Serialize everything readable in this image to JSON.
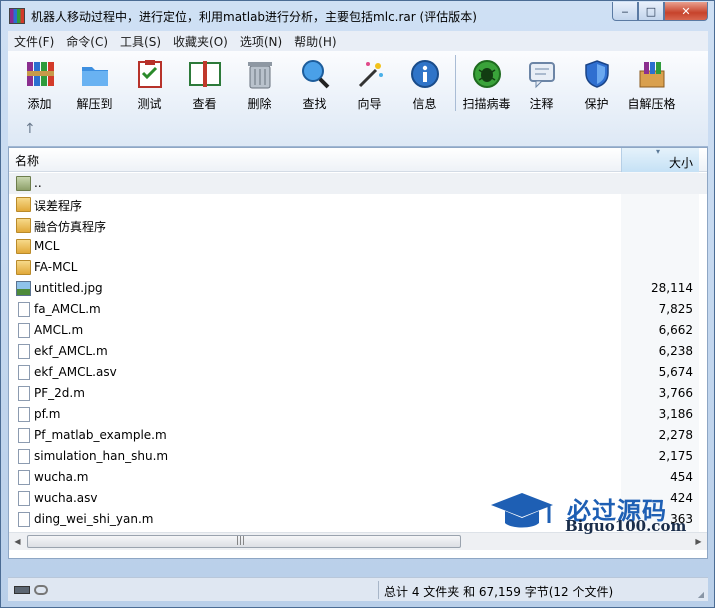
{
  "window": {
    "title": "机器人移动过程中，进行定位，利用matlab进行分析，主要包括mlc.rar (评估版本)"
  },
  "menu": [
    "文件(F)",
    "命令(C)",
    "工具(S)",
    "收藏夹(O)",
    "选项(N)",
    "帮助(H)"
  ],
  "toolbar": {
    "buttons": [
      {
        "label": "添加",
        "icon": "add-archive-icon"
      },
      {
        "label": "解压到",
        "icon": "extract-to-icon"
      },
      {
        "label": "测试",
        "icon": "test-icon"
      },
      {
        "label": "查看",
        "icon": "view-icon"
      },
      {
        "label": "删除",
        "icon": "delete-icon"
      },
      {
        "label": "查找",
        "icon": "find-icon"
      },
      {
        "label": "向导",
        "icon": "wizard-icon"
      },
      {
        "label": "信息",
        "icon": "info-icon"
      },
      {
        "label": "扫描病毒",
        "icon": "virus-scan-icon"
      },
      {
        "label": "注释",
        "icon": "comment-icon"
      },
      {
        "label": "保护",
        "icon": "protect-icon"
      },
      {
        "label": "自解压格",
        "icon": "sfx-icon"
      }
    ],
    "up_symbol": "↑"
  },
  "columns": {
    "name": "名称",
    "size": "大小"
  },
  "files": [
    {
      "name": "..",
      "size": "",
      "type": "folder-up"
    },
    {
      "name": "误差程序",
      "size": "",
      "type": "folder"
    },
    {
      "name": "融合仿真程序",
      "size": "",
      "type": "folder"
    },
    {
      "name": "MCL",
      "size": "",
      "type": "folder"
    },
    {
      "name": "FA-MCL",
      "size": "",
      "type": "folder"
    },
    {
      "name": "untitled.jpg",
      "size": "28,114",
      "type": "image"
    },
    {
      "name": "fa_AMCL.m",
      "size": "7,825",
      "type": "file"
    },
    {
      "name": "AMCL.m",
      "size": "6,662",
      "type": "file"
    },
    {
      "name": "ekf_AMCL.m",
      "size": "6,238",
      "type": "file"
    },
    {
      "name": "ekf_AMCL.asv",
      "size": "5,674",
      "type": "file"
    },
    {
      "name": "PF_2d.m",
      "size": "3,766",
      "type": "file"
    },
    {
      "name": "pf.m",
      "size": "3,186",
      "type": "file"
    },
    {
      "name": "Pf_matlab_example.m",
      "size": "2,278",
      "type": "file"
    },
    {
      "name": "simulation_han_shu.m",
      "size": "2,175",
      "type": "file"
    },
    {
      "name": "wucha.m",
      "size": "454",
      "type": "file"
    },
    {
      "name": "wucha.asv",
      "size": "424",
      "type": "file"
    },
    {
      "name": "ding_wei_shi_yan.m",
      "size": "363",
      "type": "file"
    }
  ],
  "scrollbar": {
    "grip": "|||"
  },
  "watermark": {
    "title": "必过源码",
    "url": "Biguo100.com"
  },
  "status": {
    "text": "总计 4 文件夹 和 67,159 字节(12 个文件)"
  }
}
